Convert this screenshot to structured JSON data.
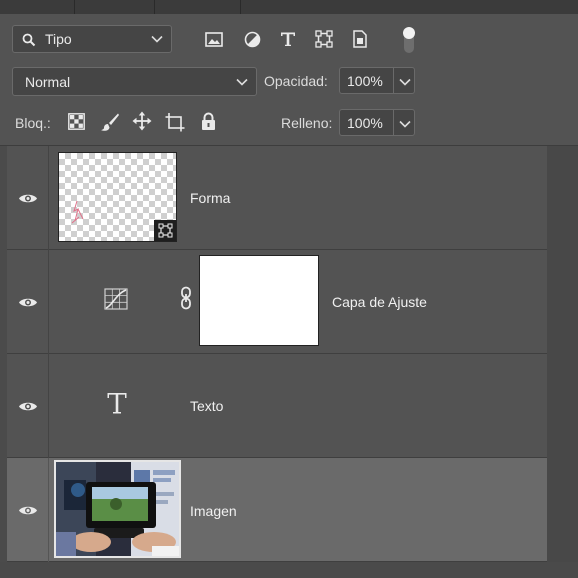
{
  "toolbar": {
    "filter_label": "Tipo",
    "blend_mode": "Normal",
    "opacity_label": "Opacidad:",
    "opacity_value": "100%",
    "lock_label": "Bloq.:",
    "fill_label": "Relleno:",
    "fill_value": "100%"
  },
  "layers": [
    {
      "name": "Forma",
      "type": "shape",
      "visible": true,
      "selected": false
    },
    {
      "name": "Capa de Ajuste",
      "type": "adjustment",
      "visible": true,
      "selected": false
    },
    {
      "name": "Texto",
      "type": "text",
      "visible": true,
      "selected": false
    },
    {
      "name": "Imagen",
      "type": "image",
      "visible": true,
      "selected": true
    }
  ],
  "colors": {
    "panel_bg": "#535353",
    "selected_layer_bg": "#6a6a6a",
    "field_bg": "#454545",
    "text": "#e8e8e8"
  },
  "icons": {
    "filter_search": "search-icon",
    "filter_image": "image-filter-icon",
    "filter_adjustment": "adjustment-filter-icon",
    "filter_text": "text-filter-icon",
    "filter_shape": "shape-filter-icon",
    "filter_smart": "smart-object-filter-icon",
    "filter_toggle": "filter-toggle-icon",
    "lock_transparent": "lock-transparent-pixels-icon",
    "lock_image": "lock-image-pixels-icon",
    "lock_position": "lock-position-icon",
    "lock_artboard": "lock-artboard-icon",
    "lock_all": "lock-all-icon",
    "visibility": "eye-icon",
    "mask_link": "chain-link-icon",
    "adjustment_thumb": "curves-adjustment-icon",
    "text_thumb": "text-layer-icon",
    "shape_badge": "shape-layer-badge-icon"
  }
}
